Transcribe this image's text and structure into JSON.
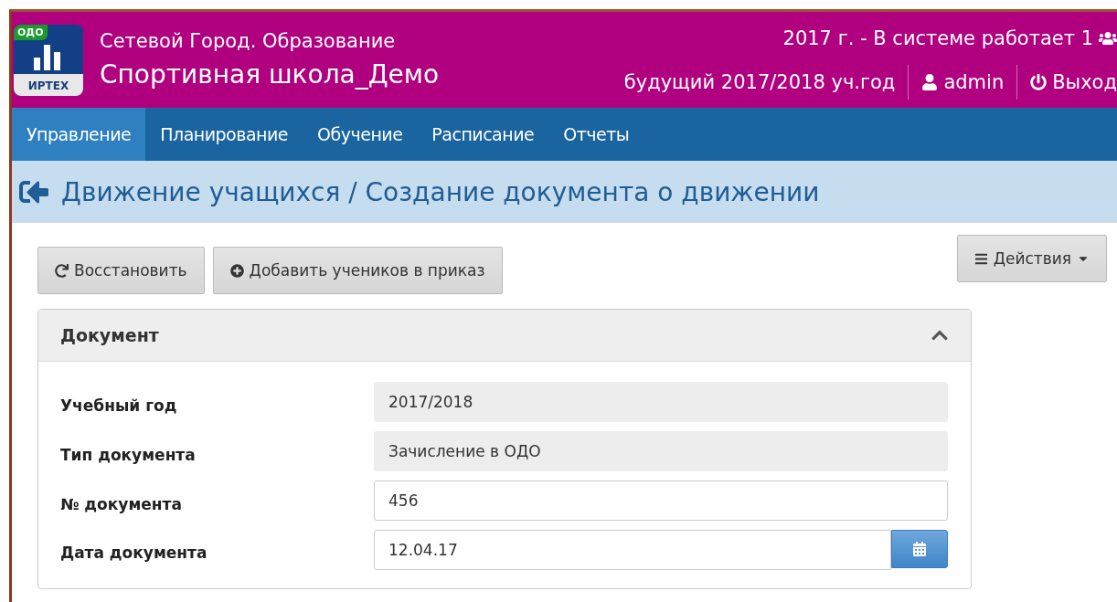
{
  "logo": {
    "badge": "ОДО",
    "brand": "ИРТЕХ"
  },
  "header": {
    "system": "Сетевой Город. Образование",
    "school": "Спортивная школа_Демо",
    "status": "2017 г. - В системе работает 1",
    "year": "будущий 2017/2018 уч.год",
    "user": "admin",
    "logout": "Выход"
  },
  "nav": [
    {
      "label": "Управление",
      "selected": true
    },
    {
      "label": "Планирование",
      "selected": false
    },
    {
      "label": "Обучение",
      "selected": false
    },
    {
      "label": "Расписание",
      "selected": false
    },
    {
      "label": "Отчеты",
      "selected": false
    }
  ],
  "page_title": "Движение учащихся / Создание документа о движении",
  "toolbar": [
    {
      "kind": "restore",
      "label": "Восстановить"
    },
    {
      "kind": "add",
      "label": "Добавить учеников в приказ"
    }
  ],
  "actions_button": "Действия",
  "panel": {
    "title": "Документ",
    "expanded": true,
    "fields": [
      {
        "label": "Учебный год",
        "value": "2017/2018",
        "kind": "readonly"
      },
      {
        "label": "Тип документа",
        "value": "Зачисление в ОДО",
        "kind": "readonly"
      },
      {
        "label": "№ документа",
        "value": "456",
        "kind": "text"
      },
      {
        "label": "Дата документа",
        "value": "12.04.17",
        "kind": "date"
      }
    ]
  }
}
